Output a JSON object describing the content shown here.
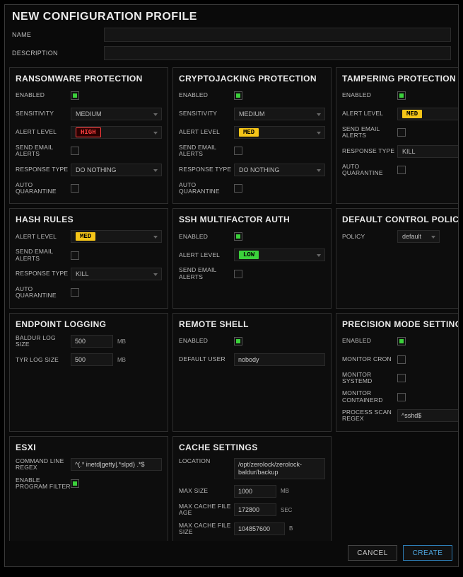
{
  "dialog": {
    "title": "NEW CONFIGURATION PROFILE",
    "name_label": "NAME",
    "name_value": "",
    "description_label": "DESCRIPTION",
    "description_value": ""
  },
  "panels": {
    "ransomware": {
      "title": "RANSOMWARE PROTECTION",
      "enabled_label": "ENABLED",
      "enabled": true,
      "sensitivity_label": "SENSITIVITY",
      "sensitivity": "MEDIUM",
      "alert_label": "ALERT LEVEL",
      "alert_badge": "HIGH",
      "send_email_label": "SEND EMAIL ALERTS",
      "send_email": false,
      "response_label": "RESPONSE TYPE",
      "response": "DO NOTHING",
      "auto_q_label": "AUTO QUARANTINE",
      "auto_q": false
    },
    "crypto": {
      "title": "CRYPTOJACKING PROTECTION",
      "enabled_label": "ENABLED",
      "enabled": true,
      "sensitivity_label": "SENSITIVITY",
      "sensitivity": "MEDIUM",
      "alert_label": "ALERT LEVEL",
      "alert_badge": "MED",
      "send_email_label": "SEND EMAIL ALERTS",
      "send_email": false,
      "response_label": "RESPONSE TYPE",
      "response": "DO NOTHING",
      "auto_q_label": "AUTO QUARANTINE",
      "auto_q": false
    },
    "tampering": {
      "title": "TAMPERING PROTECTION",
      "enabled_label": "ENABLED",
      "enabled": true,
      "alert_label": "ALERT LEVEL",
      "alert_badge": "MED",
      "send_email_label": "SEND EMAIL ALERTS",
      "send_email": false,
      "response_label": "RESPONSE TYPE",
      "response": "KILL",
      "auto_q_label": "AUTO QUARANTINE",
      "auto_q": false
    },
    "hash": {
      "title": "HASH RULES",
      "alert_label": "ALERT LEVEL",
      "alert_badge": "MED",
      "send_email_label": "SEND EMAIL ALERTS",
      "send_email": false,
      "response_label": "RESPONSE TYPE",
      "response": "KILL",
      "auto_q_label": "AUTO QUARANTINE",
      "auto_q": false
    },
    "ssh": {
      "title": "SSH MULTIFACTOR AUTH",
      "enabled_label": "ENABLED",
      "enabled": true,
      "alert_label": "ALERT LEVEL",
      "alert_badge": "LOW",
      "send_email_label": "SEND EMAIL ALERTS",
      "send_email": false
    },
    "policy": {
      "title": "DEFAULT CONTROL POLICY",
      "policy_label": "POLICY",
      "policy": "default"
    },
    "logging": {
      "title": "ENDPOINT LOGGING",
      "baldur_label": "BALDUR LOG SIZE",
      "baldur_value": "500",
      "tyr_label": "TYR LOG SIZE",
      "tyr_value": "500",
      "unit_mb": "MB"
    },
    "remote": {
      "title": "REMOTE SHELL",
      "enabled_label": "ENABLED",
      "enabled": true,
      "user_label": "DEFAULT USER",
      "user_value": "nobody"
    },
    "precision": {
      "title": "PRECISION MODE SETTINGS",
      "enabled_label": "ENABLED",
      "enabled": true,
      "cron_label": "MONITOR CRON",
      "cron": false,
      "systemd_label": "MONITOR SYSTEMD",
      "systemd": false,
      "containerd_label": "MONITOR CONTAINERD",
      "containerd": false,
      "regex_label": "PROCESS SCAN REGEX",
      "regex_value": "^sshd$"
    },
    "esxi": {
      "title": "ESXI",
      "regex_label": "COMMAND LINE REGEX",
      "regex_value": "^(.* inetd|getty|.*slpd) .*$",
      "filter_label": "ENABLE PROGRAM FILTER",
      "filter": true
    },
    "cache": {
      "title": "CACHE SETTINGS",
      "location_label": "LOCATION",
      "location_value": "/opt/zerolock/zerolock-baldur/backup",
      "maxsize_label": "MAX SIZE",
      "maxsize_value": "1000",
      "unit_mb": "MB",
      "maxage_label": "MAX CACHE FILE AGE",
      "maxage_value": "172800",
      "unit_sec": "SEC",
      "maxfile_label": "MAX CACHE FILE SIZE",
      "maxfile_value": "104857600",
      "unit_b": "B"
    }
  },
  "footer": {
    "cancel": "CANCEL",
    "create": "CREATE"
  }
}
